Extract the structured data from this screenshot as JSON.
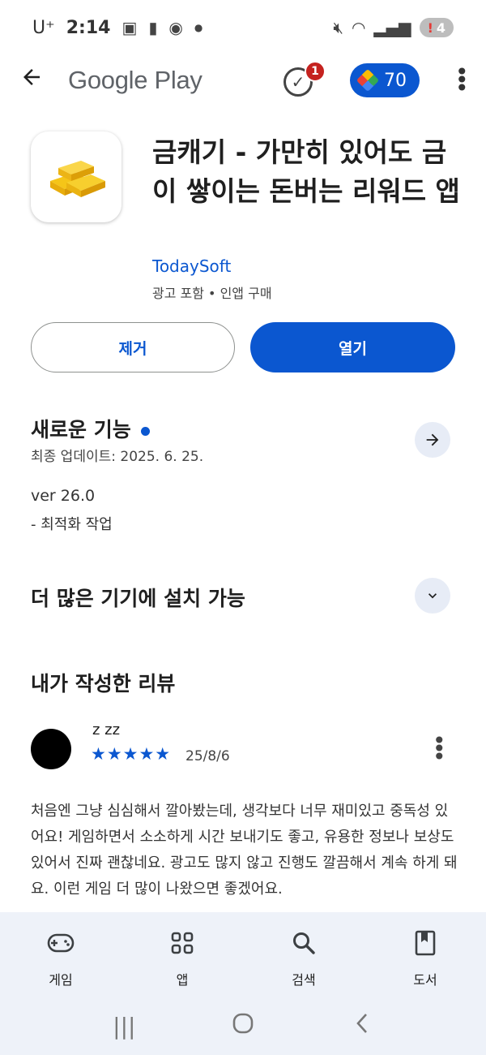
{
  "status_bar": {
    "carrier": "U⁺",
    "time": "2:14",
    "battery_level": "4"
  },
  "app_bar": {
    "logo": "Google Play",
    "notification_count": "1",
    "play_points": "70"
  },
  "app": {
    "title": "금캐기 - 가만히 있어도 금이 쌓이는 돈버는 리워드 앱",
    "developer": "TodaySoft",
    "meta": "광고 포함 • 인앱 구매",
    "remove_label": "제거",
    "open_label": "열기"
  },
  "whats_new": {
    "title": "새로운 기능",
    "updated": "최종 업데이트: 2025. 6. 25.",
    "version": "ver 26.0",
    "notes": "- 최적화 작업"
  },
  "more_devices": {
    "title": "더 많은 기기에 설치 가능"
  },
  "my_review": {
    "title": "내가 작성한 리뷰",
    "reviewer": "z zz",
    "rating": 5,
    "stars": "★★★★★",
    "date": "25/8/6",
    "text": "처음엔 그냥 심심해서 깔아봤는데, 생각보다 너무 재미있고 중독성 있어요! 게임하면서 소소하게 시간 보내기도 좋고, 유용한 정보나 보상도 있어서 진짜 괜찮네요. 광고도 많지 않고 진행도 깔끔해서 계속 하게 돼요. 이런 게임 더 많이 나왔으면 좋겠어요."
  },
  "bottom_nav": [
    {
      "label": "게임",
      "icon": "gamepad-icon"
    },
    {
      "label": "앱",
      "icon": "apps-grid-icon"
    },
    {
      "label": "검색",
      "icon": "search-icon"
    },
    {
      "label": "도서",
      "icon": "book-icon"
    }
  ],
  "colors": {
    "accent": "#0b57d0",
    "nav_bg": "#eef2f9",
    "badge": "#c5221f"
  }
}
